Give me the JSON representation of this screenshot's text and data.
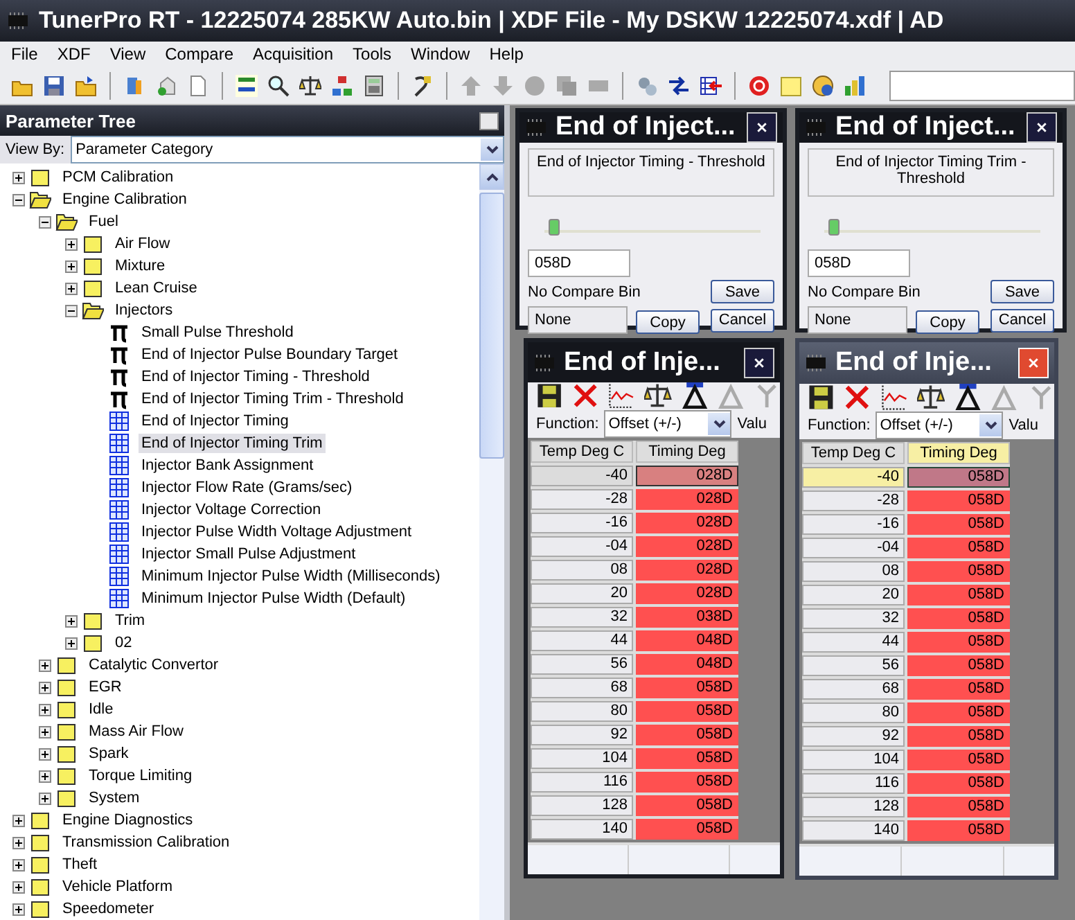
{
  "window": {
    "title": "TunerPro RT - 12225074 285KW Auto.bin | XDF File - My DSKW  12225074.xdf | AD"
  },
  "menu": [
    "File",
    "XDF",
    "View",
    "Compare",
    "Acquisition",
    "Tools",
    "Window",
    "Help"
  ],
  "tree_panel": {
    "title": "Parameter Tree",
    "view_by_label": "View By:",
    "view_by_value": "Parameter Category"
  },
  "tree": [
    {
      "label": "PCM Calibration",
      "kind": "folder",
      "expanded": false,
      "selected": false
    },
    {
      "label": "Engine Calibration",
      "kind": "folder",
      "expanded": true,
      "selected": false,
      "children": [
        {
          "label": "Fuel",
          "kind": "folder",
          "expanded": true,
          "selected": false,
          "children": [
            {
              "label": "Air Flow",
              "kind": "folder",
              "expanded": false,
              "selected": false
            },
            {
              "label": "Mixture",
              "kind": "folder",
              "expanded": false,
              "selected": false
            },
            {
              "label": "Lean Cruise",
              "kind": "folder",
              "expanded": false,
              "selected": false
            },
            {
              "label": "Injectors",
              "kind": "folder",
              "expanded": true,
              "selected": false,
              "children": [
                {
                  "label": "Small Pulse Threshold",
                  "kind": "scalar",
                  "selected": false
                },
                {
                  "label": "End of Injector Pulse Boundary Target",
                  "kind": "scalar",
                  "selected": false
                },
                {
                  "label": "End of Injector Timing - Threshold",
                  "kind": "scalar",
                  "selected": false
                },
                {
                  "label": "End of Injector Timing Trim - Threshold",
                  "kind": "scalar",
                  "selected": false
                },
                {
                  "label": "End of Injector Timing",
                  "kind": "table",
                  "selected": false
                },
                {
                  "label": "End of Injector Timing Trim",
                  "kind": "table",
                  "selected": true
                },
                {
                  "label": "Injector Bank Assignment",
                  "kind": "table",
                  "selected": false
                },
                {
                  "label": "Injector Flow Rate (Grams/sec)",
                  "kind": "table",
                  "selected": false
                },
                {
                  "label": "Injector Voltage Correction",
                  "kind": "table",
                  "selected": false
                },
                {
                  "label": "Injector Pulse Width Voltage Adjustment",
                  "kind": "table",
                  "selected": false
                },
                {
                  "label": "Injector Small Pulse Adjustment",
                  "kind": "table",
                  "selected": false
                },
                {
                  "label": "Minimum Injector Pulse Width (Milliseconds)",
                  "kind": "table",
                  "selected": false
                },
                {
                  "label": "Minimum Injector Pulse Width (Default)",
                  "kind": "table",
                  "selected": false
                }
              ]
            },
            {
              "label": "Trim",
              "kind": "folder",
              "expanded": false,
              "selected": false
            },
            {
              "label": "02",
              "kind": "folder",
              "expanded": false,
              "selected": false
            }
          ]
        },
        {
          "label": "Catalytic Convertor",
          "kind": "folder",
          "expanded": false,
          "selected": false
        },
        {
          "label": "EGR",
          "kind": "folder",
          "expanded": false,
          "selected": false
        },
        {
          "label": "Idle",
          "kind": "folder",
          "expanded": false,
          "selected": false
        },
        {
          "label": "Mass Air Flow",
          "kind": "folder",
          "expanded": false,
          "selected": false
        },
        {
          "label": "Spark",
          "kind": "folder",
          "expanded": false,
          "selected": false
        },
        {
          "label": "Torque Limiting",
          "kind": "folder",
          "expanded": false,
          "selected": false
        },
        {
          "label": "System",
          "kind": "folder",
          "expanded": false,
          "selected": false
        }
      ]
    },
    {
      "label": "Engine Diagnostics",
      "kind": "folder",
      "expanded": false,
      "selected": false
    },
    {
      "label": "Transmission Calibration",
      "kind": "folder",
      "expanded": false,
      "selected": false
    },
    {
      "label": "Theft",
      "kind": "folder",
      "expanded": false,
      "selected": false
    },
    {
      "label": "Vehicle Platform",
      "kind": "folder",
      "expanded": false,
      "selected": false
    },
    {
      "label": "Speedometer",
      "kind": "folder",
      "expanded": false,
      "selected": false
    }
  ],
  "windows": [
    {
      "kind": "scalar",
      "active": false,
      "title": "End of Inject...",
      "description": "End of Injector Timing - Threshold",
      "level": 0.02,
      "value": "058D",
      "compare_label": "No Compare Bin",
      "compare_value": "None",
      "copy": "Copy",
      "save": "Save",
      "cancel": "Cancel"
    },
    {
      "kind": "scalar",
      "active": false,
      "title": "End of Inject...",
      "description": "End of Injector Timing Trim - Threshold",
      "level": 0.02,
      "value": "058D",
      "compare_label": "No Compare Bin",
      "compare_value": "None",
      "copy": "Copy",
      "save": "Save",
      "cancel": "Cancel"
    },
    {
      "kind": "table",
      "active": false,
      "title": "End of Inje...",
      "function_label": "Function:",
      "function_value": "Offset (+/-)",
      "value_label": "Valu",
      "columns": [
        "Temp Deg C",
        "Timing Deg"
      ],
      "rows": [
        {
          "temp": "-40",
          "value": "028D",
          "selected": true
        },
        {
          "temp": "-28",
          "value": "028D",
          "selected": false
        },
        {
          "temp": "-16",
          "value": "028D",
          "selected": false
        },
        {
          "temp": "-04",
          "value": "028D",
          "selected": false
        },
        {
          "temp": "08",
          "value": "028D",
          "selected": false
        },
        {
          "temp": "20",
          "value": "028D",
          "selected": false
        },
        {
          "temp": "32",
          "value": "038D",
          "selected": false
        },
        {
          "temp": "44",
          "value": "048D",
          "selected": false
        },
        {
          "temp": "56",
          "value": "048D",
          "selected": false
        },
        {
          "temp": "68",
          "value": "058D",
          "selected": false
        },
        {
          "temp": "80",
          "value": "058D",
          "selected": false
        },
        {
          "temp": "92",
          "value": "058D",
          "selected": false
        },
        {
          "temp": "104",
          "value": "058D",
          "selected": false
        },
        {
          "temp": "116",
          "value": "058D",
          "selected": false
        },
        {
          "temp": "128",
          "value": "058D",
          "selected": false
        },
        {
          "temp": "140",
          "value": "058D",
          "selected": false
        }
      ]
    },
    {
      "kind": "table",
      "active": true,
      "title": "End of Inje...",
      "function_label": "Function:",
      "function_value": "Offset (+/-)",
      "value_label": "Valu",
      "columns": [
        "Temp Deg C",
        "Timing Deg"
      ],
      "rows": [
        {
          "temp": "-40",
          "value": "058D",
          "selected": true
        },
        {
          "temp": "-28",
          "value": "058D",
          "selected": false
        },
        {
          "temp": "-16",
          "value": "058D",
          "selected": false
        },
        {
          "temp": "-04",
          "value": "058D",
          "selected": false
        },
        {
          "temp": "08",
          "value": "058D",
          "selected": false
        },
        {
          "temp": "20",
          "value": "058D",
          "selected": false
        },
        {
          "temp": "32",
          "value": "058D",
          "selected": false
        },
        {
          "temp": "44",
          "value": "058D",
          "selected": false
        },
        {
          "temp": "56",
          "value": "058D",
          "selected": false
        },
        {
          "temp": "68",
          "value": "058D",
          "selected": false
        },
        {
          "temp": "80",
          "value": "058D",
          "selected": false
        },
        {
          "temp": "92",
          "value": "058D",
          "selected": false
        },
        {
          "temp": "104",
          "value": "058D",
          "selected": false
        },
        {
          "temp": "116",
          "value": "058D",
          "selected": false
        },
        {
          "temp": "128",
          "value": "058D",
          "selected": false
        },
        {
          "temp": "140",
          "value": "058D",
          "selected": false
        }
      ]
    }
  ]
}
